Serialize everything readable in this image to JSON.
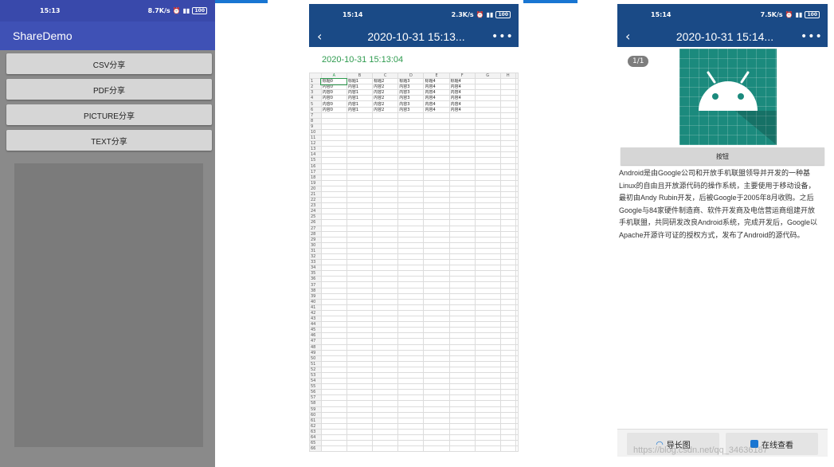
{
  "panel1": {
    "status": {
      "time": "15:13",
      "right": "8.7K/s"
    },
    "app_title": "ShareDemo",
    "buttons": [
      "CSV分享",
      "PDF分享",
      "PICTURE分享",
      "TEXT分享"
    ]
  },
  "panel2": {
    "status": {
      "time": "15:14",
      "right": "2.3K/s"
    },
    "title": "2020-10-31 15:13...",
    "timestamp": "2020-10-31 15:13:04",
    "sheet": {
      "columns": [
        "A",
        "B",
        "C",
        "D",
        "E",
        "F",
        "G",
        "H"
      ],
      "rows": [
        [
          "标题0",
          "标题1",
          "标题2",
          "标题3",
          "标题4",
          "标题4"
        ],
        [
          "内容0",
          "内容1",
          "内容2",
          "内容3",
          "内容4",
          "内容4"
        ],
        [
          "内容0",
          "内容1",
          "内容2",
          "内容3",
          "内容4",
          "内容4"
        ],
        [
          "内容0",
          "内容1",
          "内容2",
          "内容3",
          "内容4",
          "内容4"
        ],
        [
          "内容0",
          "内容1",
          "内容2",
          "内容3",
          "内容4",
          "内容4"
        ],
        [
          "内容0",
          "内容1",
          "内容2",
          "内容3",
          "内容4",
          "内容4"
        ]
      ],
      "row_count": 66
    }
  },
  "panel3": {
    "status": {
      "time": "15:14",
      "right": "7.5K/s"
    },
    "title": "2020-10-31 15:14...",
    "counter": "1/1",
    "button_label": "按钮",
    "body_lines": [
      "Android是由Google公司和开放手机联盟领导并开发的一种基",
      "Linux的自由且开放源代码的操作系统，主要使用于移动设备，",
      "最初由Andy Rubin开发，后被Google于2005年8月收购。之后",
      "Google与84家硬件制造商、软件开发商及电信营运商组建开放",
      "手机联盟，共同研发改良Android系统，完成开发后，Google以",
      "Apache开源许可证的授权方式，发布了Android的源代码。"
    ],
    "bottom_buttons": [
      "导长图",
      "在线查看"
    ]
  },
  "watermark": "https://blog.csdn.net/qq_34636187",
  "colors": {
    "indigo": "#3f51b5",
    "navy": "#1a4a86",
    "green": "#2e9b4f",
    "teal": "#1b8a7d",
    "android_white": "#ffffff"
  }
}
